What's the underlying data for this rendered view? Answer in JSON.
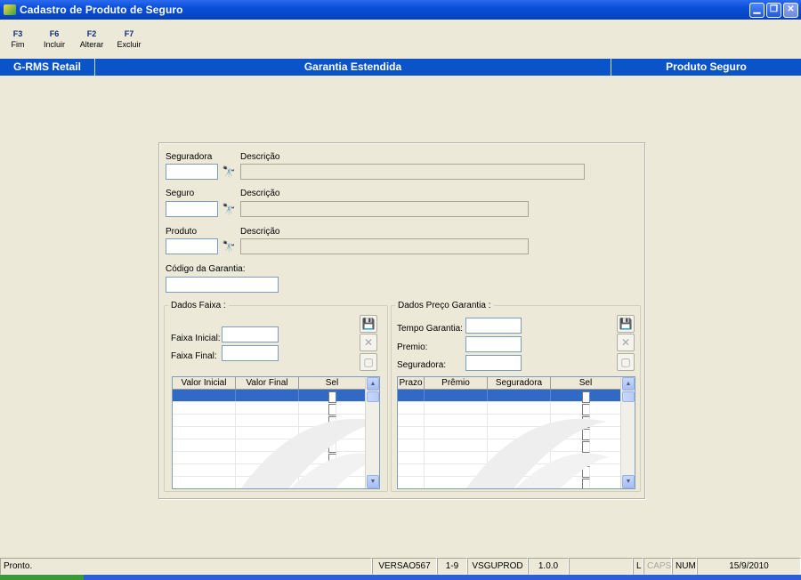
{
  "window": {
    "title": "Cadastro de Produto de Seguro"
  },
  "toolbar": [
    {
      "key": "F3",
      "label": "Fim"
    },
    {
      "key": "F6",
      "label": "Incluir"
    },
    {
      "key": "F2",
      "label": "Alterar"
    },
    {
      "key": "F7",
      "label": "Excluir"
    }
  ],
  "header": {
    "left": "G-RMS Retail",
    "center": "Garantia Estendida",
    "right": "Produto Seguro"
  },
  "form": {
    "seguradora_label": "Seguradora",
    "seguro_label": "Seguro",
    "produto_label": "Produto",
    "descricao_label": "Descrição",
    "codigo_garantia_label": "Código da Garantia:"
  },
  "faixa": {
    "legend": "Dados Faixa :",
    "faixa_inicial_label": "Faixa Inicial:",
    "faixa_final_label": "Faixa Final:",
    "columns": [
      "Valor Inicial",
      "Valor Final",
      "Sel"
    ]
  },
  "preco": {
    "legend": "Dados Preço Garantia :",
    "tempo_label": "Tempo Garantia:",
    "premio_label": "Premio:",
    "seguradora_label": "Seguradora:",
    "columns": [
      "Prazo",
      "Prêmio",
      "Seguradora",
      "Sel"
    ]
  },
  "statusbar": {
    "message": "Pronto.",
    "version": "VERSAO567",
    "page": "1-9",
    "module": "VSGUPROD",
    "build": "1.0.0",
    "l": "L",
    "caps": "CAPS",
    "num": "NUM",
    "date": "15/9/2010"
  }
}
